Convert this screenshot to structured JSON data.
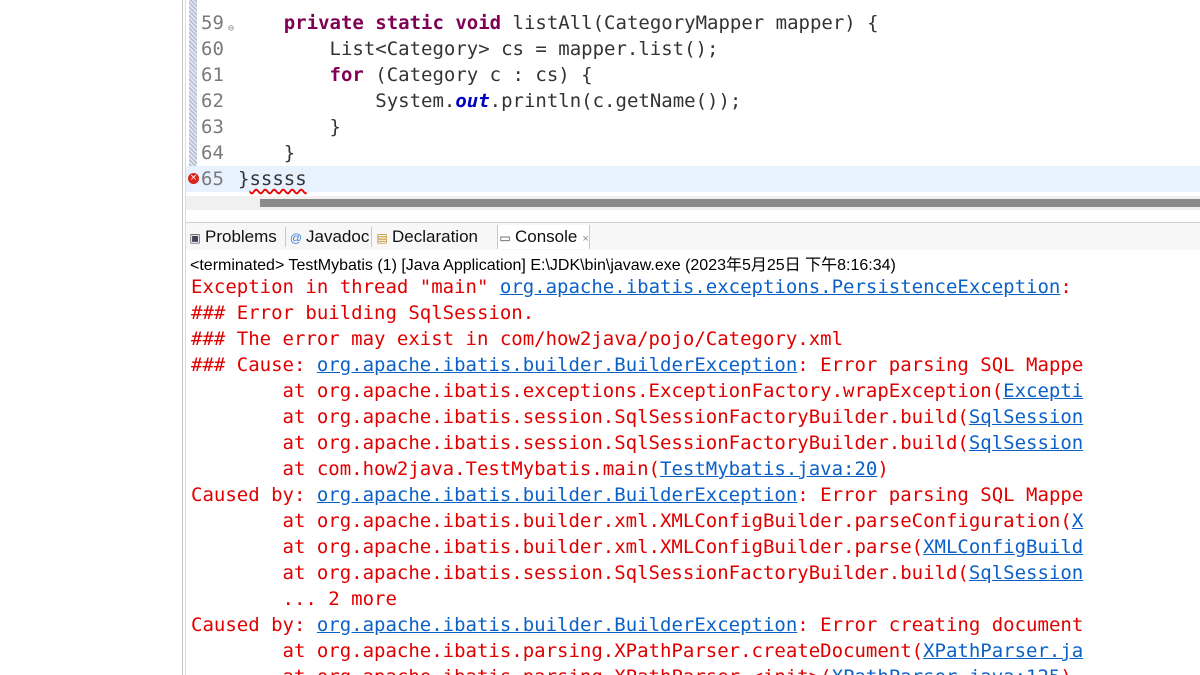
{
  "editor": {
    "lines": [
      {
        "num": "59",
        "parts": [
          {
            "t": "    "
          },
          {
            "t": "private static void",
            "c": "kw"
          },
          {
            "t": " listAll(CategoryMapper mapper) {"
          }
        ],
        "fold": true
      },
      {
        "num": "60",
        "parts": [
          {
            "t": "        List<Category> cs = mapper.list();"
          }
        ]
      },
      {
        "num": "61",
        "parts": [
          {
            "t": "        "
          },
          {
            "t": "for",
            "c": "kw"
          },
          {
            "t": " (Category c : cs) {"
          }
        ]
      },
      {
        "num": "62",
        "parts": [
          {
            "t": "            System."
          },
          {
            "t": "out",
            "c": "fld"
          },
          {
            "t": ".println(c.getName());"
          }
        ]
      },
      {
        "num": "63",
        "parts": [
          {
            "t": "        }"
          }
        ]
      },
      {
        "num": "64",
        "parts": [
          {
            "t": "    }"
          }
        ]
      },
      {
        "num": "65",
        "parts": [
          {
            "t": "}"
          },
          {
            "t": "sssss",
            "c": "err-under"
          }
        ],
        "error": true,
        "current": true
      }
    ]
  },
  "tabs": [
    {
      "label": "Problems",
      "icon": "problems-icon",
      "glyph": "▣"
    },
    {
      "label": "Javadoc",
      "icon": "javadoc-icon",
      "glyph": "@"
    },
    {
      "label": "Declaration",
      "icon": "declaration-icon",
      "glyph": "▤"
    },
    {
      "label": "Console",
      "icon": "console-icon",
      "glyph": "▭",
      "active": true,
      "close": "×"
    }
  ],
  "console": {
    "status": "<terminated> TestMybatis (1) [Java Application] E:\\JDK\\bin\\javaw.exe (2023年5月25日 下午8:16:34)",
    "lines": [
      [
        {
          "t": "Exception in thread \"main\" "
        },
        {
          "t": "org.apache.ibatis.exceptions.PersistenceException",
          "l": true
        },
        {
          "t": ": "
        }
      ],
      [
        {
          "t": "### Error building SqlSession."
        }
      ],
      [
        {
          "t": "### The error may exist in com/how2java/pojo/Category.xml"
        }
      ],
      [
        {
          "t": "### Cause: "
        },
        {
          "t": "org.apache.ibatis.builder.BuilderException",
          "l": true
        },
        {
          "t": ": Error parsing SQL Mappe"
        }
      ],
      [
        {
          "t": "        at org.apache.ibatis.exceptions.ExceptionFactory.wrapException("
        },
        {
          "t": "Excepti",
          "l": true
        }
      ],
      [
        {
          "t": "        at org.apache.ibatis.session.SqlSessionFactoryBuilder.build("
        },
        {
          "t": "SqlSession",
          "l": true
        }
      ],
      [
        {
          "t": "        at org.apache.ibatis.session.SqlSessionFactoryBuilder.build("
        },
        {
          "t": "SqlSession",
          "l": true
        }
      ],
      [
        {
          "t": "        at com.how2java.TestMybatis.main("
        },
        {
          "t": "TestMybatis.java:20",
          "l": true
        },
        {
          "t": ")"
        }
      ],
      [
        {
          "t": "Caused by: "
        },
        {
          "t": "org.apache.ibatis.builder.BuilderException",
          "l": true
        },
        {
          "t": ": Error parsing SQL Mappe"
        }
      ],
      [
        {
          "t": "        at org.apache.ibatis.builder.xml.XMLConfigBuilder.parseConfiguration("
        },
        {
          "t": "X",
          "l": true
        }
      ],
      [
        {
          "t": "        at org.apache.ibatis.builder.xml.XMLConfigBuilder.parse("
        },
        {
          "t": "XMLConfigBuild",
          "l": true
        }
      ],
      [
        {
          "t": "        at org.apache.ibatis.session.SqlSessionFactoryBuilder.build("
        },
        {
          "t": "SqlSession",
          "l": true
        }
      ],
      [
        {
          "t": "        ... 2 more"
        }
      ],
      [
        {
          "t": "Caused by: "
        },
        {
          "t": "org.apache.ibatis.builder.BuilderException",
          "l": true
        },
        {
          "t": ": Error creating document"
        }
      ],
      [
        {
          "t": "        at org.apache.ibatis.parsing.XPathParser.createDocument("
        },
        {
          "t": "XPathParser.ja",
          "l": true
        }
      ],
      [
        {
          "t": "        at org.apache.ibatis.parsing.XPathParser.<init>("
        },
        {
          "t": "XPathParser.java:125",
          "l": true
        },
        {
          "t": ")"
        }
      ]
    ]
  }
}
